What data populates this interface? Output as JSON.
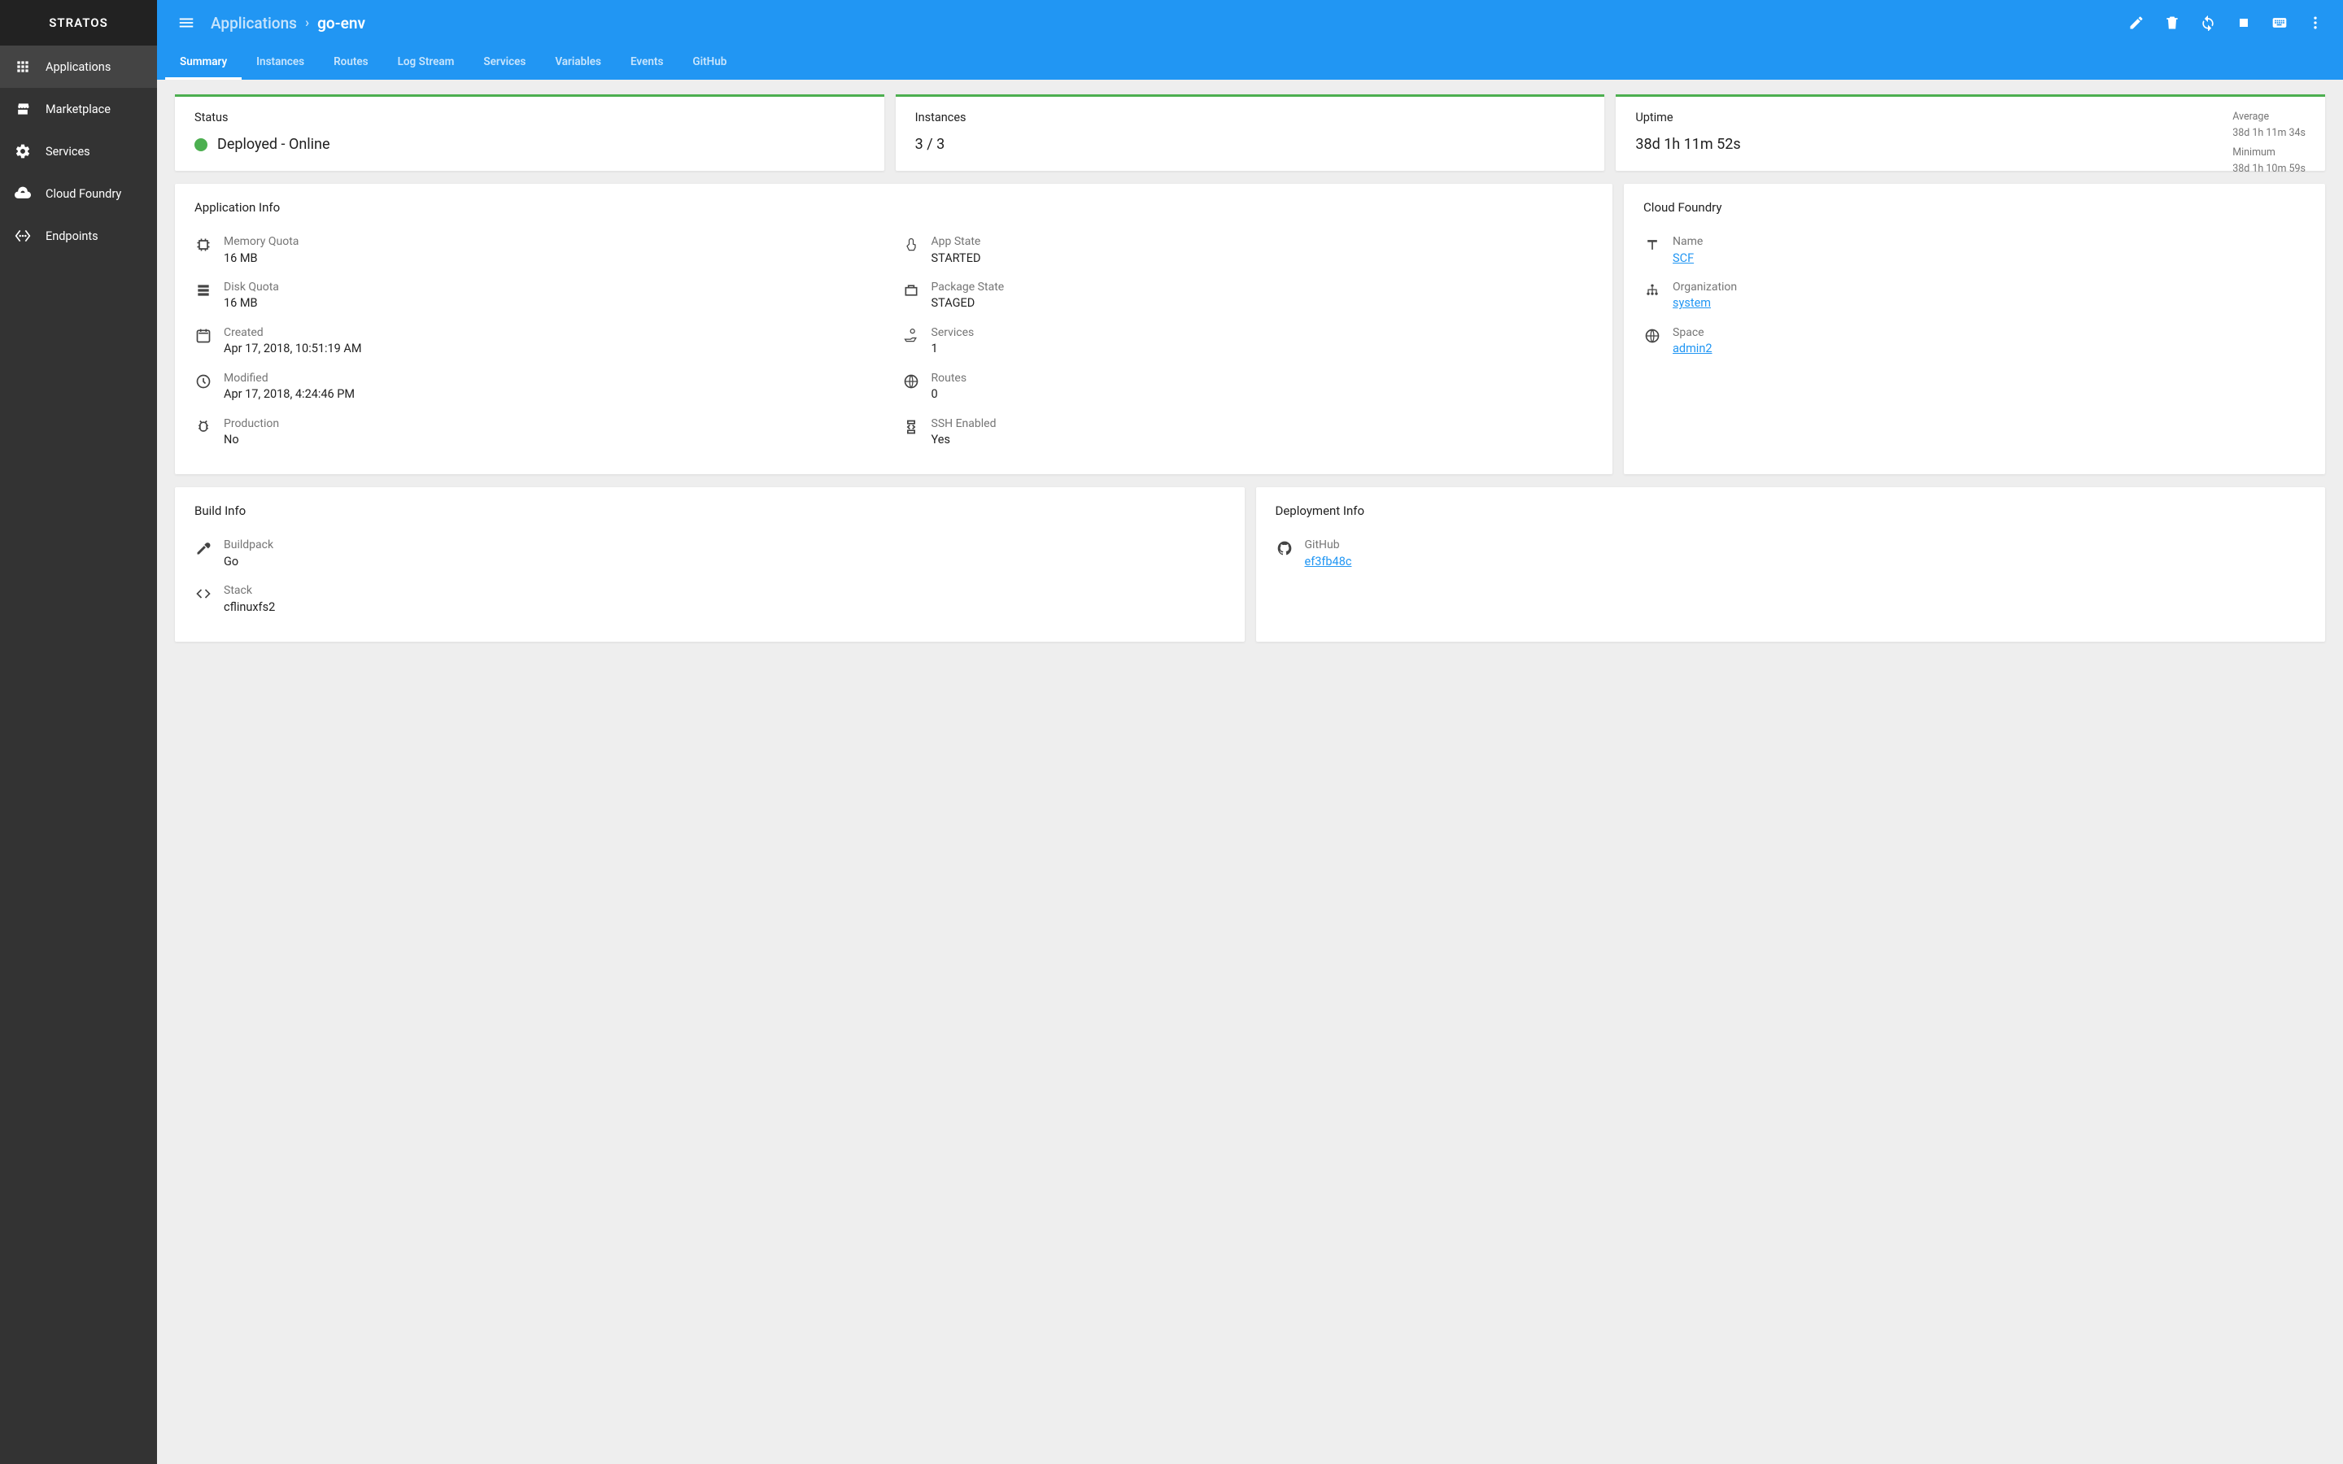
{
  "brand": "STRATOS",
  "sidebar": {
    "items": [
      {
        "label": "Applications"
      },
      {
        "label": "Marketplace"
      },
      {
        "label": "Services"
      },
      {
        "label": "Cloud Foundry"
      },
      {
        "label": "Endpoints"
      }
    ]
  },
  "breadcrumb": {
    "parent": "Applications",
    "sep": "›",
    "current": "go-env"
  },
  "tabs": [
    {
      "label": "Summary"
    },
    {
      "label": "Instances"
    },
    {
      "label": "Routes"
    },
    {
      "label": "Log Stream"
    },
    {
      "label": "Services"
    },
    {
      "label": "Variables"
    },
    {
      "label": "Events"
    },
    {
      "label": "GitHub"
    }
  ],
  "status_card": {
    "title": "Status",
    "text": "Deployed - Online"
  },
  "instances_card": {
    "title": "Instances",
    "value": "3 / 3"
  },
  "uptime_card": {
    "title": "Uptime",
    "value": "38d 1h 11m 52s",
    "avg_label": "Average",
    "avg_value": "38d 1h 11m 34s",
    "min_label": "Minimum",
    "min_value": "38d 1h 10m 59s"
  },
  "app_info": {
    "title": "Application Info",
    "left": [
      {
        "label": "Memory Quota",
        "value": "16 MB"
      },
      {
        "label": "Disk Quota",
        "value": "16 MB"
      },
      {
        "label": "Created",
        "value": "Apr 17, 2018, 10:51:19 AM"
      },
      {
        "label": "Modified",
        "value": "Apr 17, 2018, 4:24:46 PM"
      },
      {
        "label": "Production",
        "value": "No"
      }
    ],
    "right": [
      {
        "label": "App State",
        "value": "STARTED"
      },
      {
        "label": "Package State",
        "value": "STAGED"
      },
      {
        "label": "Services",
        "value": "1"
      },
      {
        "label": "Routes",
        "value": "0"
      },
      {
        "label": "SSH Enabled",
        "value": "Yes"
      }
    ]
  },
  "cf_info": {
    "title": "Cloud Foundry",
    "items": [
      {
        "label": "Name",
        "value": "SCF"
      },
      {
        "label": "Organization",
        "value": "system"
      },
      {
        "label": "Space",
        "value": "admin2"
      }
    ]
  },
  "build_info": {
    "title": "Build Info",
    "items": [
      {
        "label": "Buildpack",
        "value": "Go"
      },
      {
        "label": "Stack",
        "value": "cflinuxfs2"
      }
    ]
  },
  "deploy_info": {
    "title": "Deployment Info",
    "items": [
      {
        "label": "GitHub",
        "value": "ef3fb48c"
      }
    ]
  }
}
